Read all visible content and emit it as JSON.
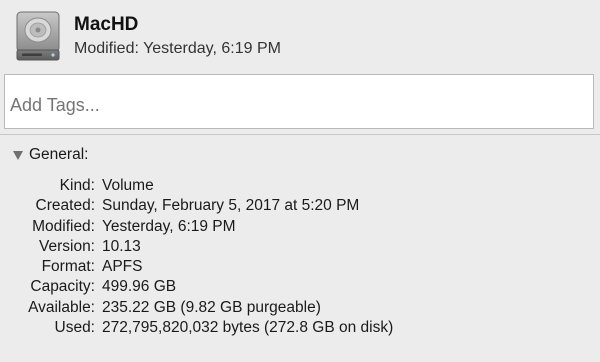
{
  "header": {
    "title": "MacHD",
    "modified": "Modified: Yesterday, 6:19 PM",
    "icon": "hard-drive-icon"
  },
  "tags": {
    "placeholder": "Add Tags..."
  },
  "general": {
    "label": "General:",
    "icon": "disclosure-triangle-icon",
    "rows": [
      {
        "label": "Kind:",
        "value": "Volume"
      },
      {
        "label": "Created:",
        "value": "Sunday, February 5, 2017 at 5:20 PM"
      },
      {
        "label": "Modified:",
        "value": "Yesterday, 6:19 PM"
      },
      {
        "label": "Version:",
        "value": "10.13"
      },
      {
        "label": "Format:",
        "value": "APFS"
      },
      {
        "label": "Capacity:",
        "value": "499.96 GB"
      },
      {
        "label": "Available:",
        "value": "235.22 GB (9.82 GB purgeable)"
      },
      {
        "label": "Used:",
        "value": "272,795,820,032 bytes (272.8 GB on disk)"
      }
    ]
  }
}
